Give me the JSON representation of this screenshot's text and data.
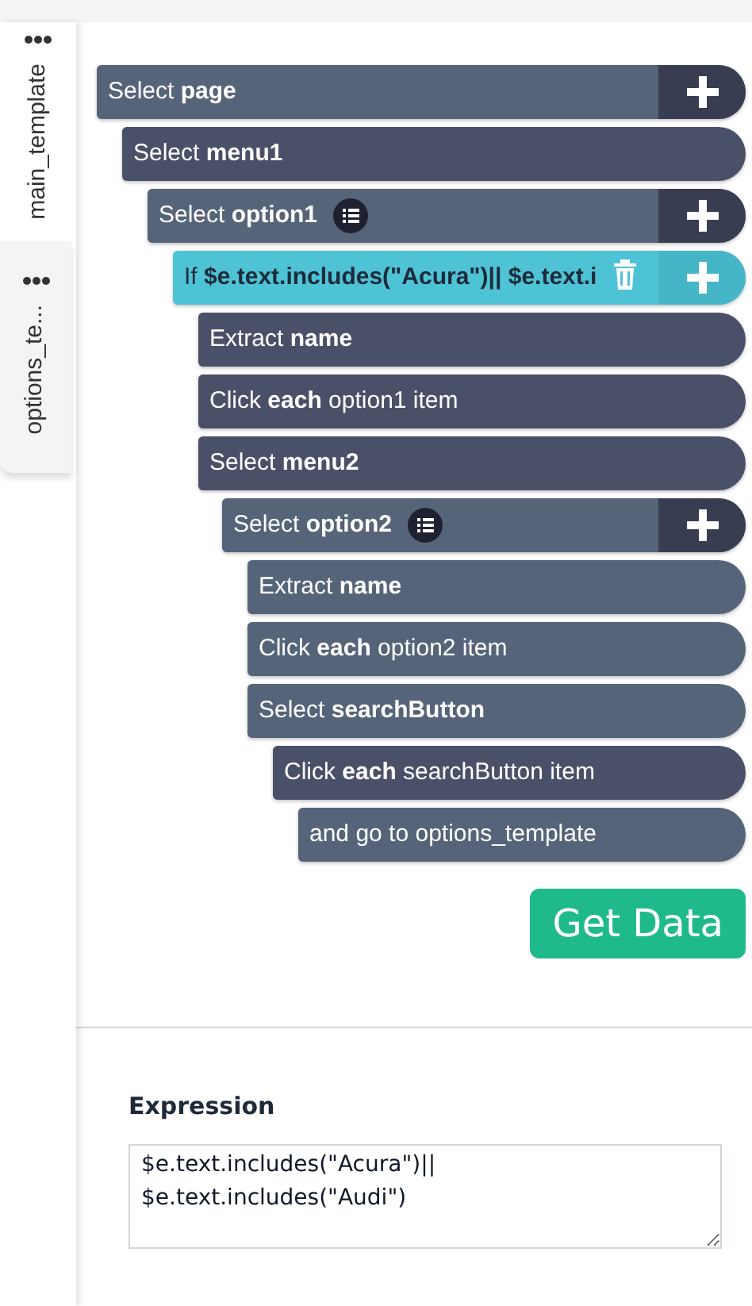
{
  "sidebar": {
    "tabs": [
      {
        "label": "main_template",
        "selected": true
      },
      {
        "label": "options_te...",
        "selected": false
      }
    ]
  },
  "steps": [
    {
      "text": "Select **page**",
      "color": "#566479",
      "add_button": true,
      "children": [
        {
          "text": "Select **menu1**",
          "color": "#4b5069",
          "children": [
            {
              "text": "Select **option1**",
              "color": "#566479",
              "list_icon": true,
              "add_button": true,
              "children": [
                {
                  "text": "If **$e.text.includes(\"Acura\")|| $e.text.i**",
                  "color": "#4ec3d5",
                  "selected": true,
                  "delete_icon": true,
                  "add_button": true,
                  "children": [
                    {
                      "text": "Extract **name**",
                      "color": "#4b5069"
                    },
                    {
                      "text": "Click **each** option1 item",
                      "color": "#4b5069"
                    },
                    {
                      "text": "Select **menu2**",
                      "color": "#4b5069",
                      "children": [
                        {
                          "text": "Select **option2**",
                          "color": "#566479",
                          "list_icon": true,
                          "add_button": true,
                          "children": [
                            {
                              "text": "Extract **name**",
                              "color": "#566479"
                            },
                            {
                              "text": "Click **each** option2 item",
                              "color": "#566479"
                            },
                            {
                              "text": "Select **searchButton**",
                              "color": "#566479",
                              "children": [
                                {
                                  "text": "Click **each** searchButton item",
                                  "color": "#4b5069",
                                  "children": [
                                    {
                                      "text": "and go to options_template",
                                      "color": "#566479"
                                    }
                                  ]
                                }
                              ]
                            }
                          ]
                        }
                      ]
                    }
                  ]
                }
              ]
            }
          ]
        }
      ]
    }
  ],
  "get_data_button": "Get Data",
  "expression": {
    "label": "Expression",
    "value": "$e.text.includes(\"Acura\")||\n$e.text.includes(\"Audi\")"
  }
}
